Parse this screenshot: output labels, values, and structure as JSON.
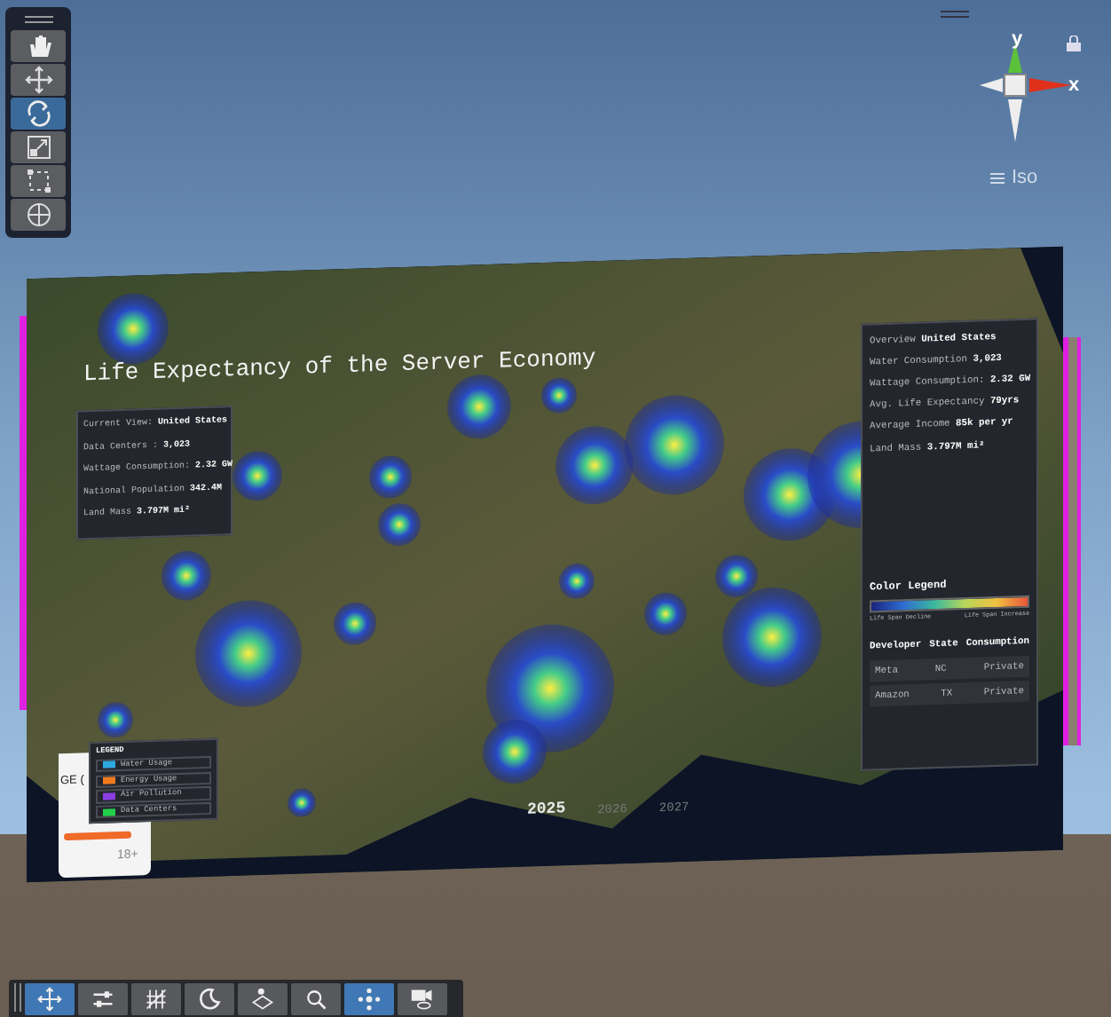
{
  "tools": [
    {
      "kind": "hand",
      "selected": false
    },
    {
      "kind": "move",
      "selected": false
    },
    {
      "kind": "rotate",
      "selected": true
    },
    {
      "kind": "scale",
      "selected": false
    },
    {
      "kind": "rect",
      "selected": false
    },
    {
      "kind": "transform",
      "selected": false
    }
  ],
  "gizmo": {
    "y_label": "y",
    "x_label": "x",
    "view": "Iso"
  },
  "title": "Life Expectancy of the Server Economy",
  "info": [
    {
      "label": "Current View:",
      "value": "United States"
    },
    {
      "label": "Data Centers :",
      "value": "3,023"
    },
    {
      "label": "Wattage Consumption:",
      "value": "2.32 GW"
    },
    {
      "label": "National Population",
      "value": "342.4M"
    },
    {
      "label": "Land Mass",
      "value": "3.797M mi²"
    }
  ],
  "overview": [
    {
      "label": "Overview",
      "value": "United States"
    },
    {
      "label": "Water Consumption",
      "value": "3,023"
    },
    {
      "label": "Wattage Consumption:",
      "value": "2.32 GW"
    },
    {
      "label": "Avg. Life Expectancy",
      "value": "79yrs"
    },
    {
      "label": "Average Income",
      "value": "85k per yr"
    },
    {
      "label": "Land Mass",
      "value": "3.797M mi²"
    }
  ],
  "color_legend": {
    "title": "Color Legend",
    "low": "Life Span Decline",
    "high": "Life Span Increase"
  },
  "table": {
    "columns": [
      "Developer",
      "State",
      "Consumption"
    ],
    "rows": [
      [
        "Meta",
        "NC",
        "Private"
      ],
      [
        "Amazon",
        "TX",
        "Private"
      ]
    ]
  },
  "legend": {
    "title": "LEGEND",
    "items": [
      {
        "label": "Water Usage",
        "color": "#2ea8e0"
      },
      {
        "label": "Energy Usage",
        "color": "#f07a1e"
      },
      {
        "label": "Air Pollution",
        "color": "#8a3ee0"
      },
      {
        "label": "Data Centers",
        "color": "#22d04a"
      }
    ]
  },
  "timeline": [
    {
      "label": "2025",
      "selected": true
    },
    {
      "label": "2026",
      "selected": false
    },
    {
      "label": "2027",
      "selected": false
    }
  ],
  "side_card": {
    "title": "GE (",
    "level": 1,
    "note": "18+"
  },
  "bottom_tools": [
    {
      "kind": "move",
      "selected": true
    },
    {
      "kind": "sliders",
      "selected": false
    },
    {
      "kind": "grid",
      "selected": false
    },
    {
      "kind": "moon",
      "selected": false
    },
    {
      "kind": "layers",
      "selected": false
    },
    {
      "kind": "search",
      "selected": false
    },
    {
      "kind": "nodes",
      "selected": true
    },
    {
      "kind": "camera",
      "selected": false
    }
  ]
}
